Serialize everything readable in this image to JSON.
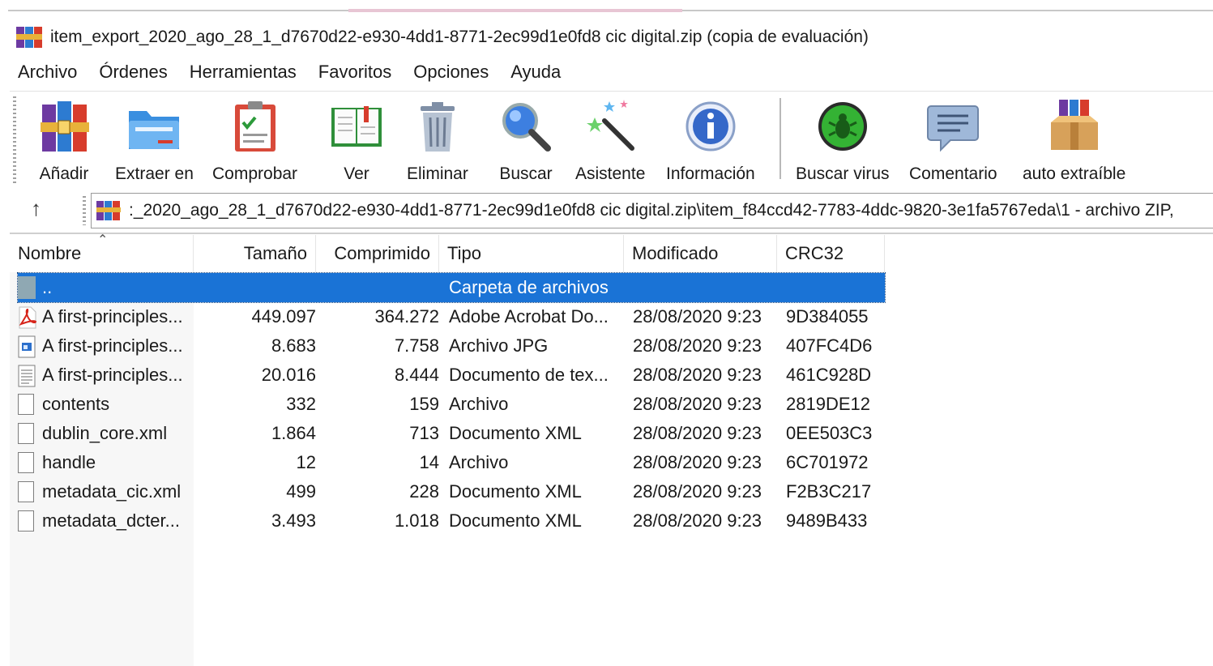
{
  "window": {
    "title": "item_export_2020_ago_28_1_d7670d22-e930-4dd1-8771-2ec99d1e0fd8 cic digital.zip (copia de evaluación)",
    "app_icon": "winrar-books-icon"
  },
  "menu": {
    "items": [
      "Archivo",
      "Órdenes",
      "Herramientas",
      "Favoritos",
      "Opciones",
      "Ayuda"
    ]
  },
  "toolbar": {
    "buttons": [
      {
        "label": "Añadir",
        "icon": "add-archive-icon"
      },
      {
        "label": "Extraer en",
        "icon": "extract-folder-icon"
      },
      {
        "label": "Comprobar",
        "icon": "test-clipboard-icon"
      },
      {
        "label": "Ver",
        "icon": "view-book-icon"
      },
      {
        "label": "Eliminar",
        "icon": "trash-icon"
      },
      {
        "label": "Buscar",
        "icon": "magnifier-icon"
      },
      {
        "label": "Asistente",
        "icon": "wizard-wand-icon"
      },
      {
        "label": "Información",
        "icon": "info-icon"
      },
      {
        "label": "Buscar virus",
        "icon": "virus-scan-icon"
      },
      {
        "label": "Comentario",
        "icon": "comment-icon"
      },
      {
        "label": "auto extraíble",
        "icon": "sfx-box-icon"
      }
    ]
  },
  "address": {
    "path": ":_2020_ago_28_1_d7670d22-e930-4dd1-8771-2ec99d1e0fd8 cic digital.zip\\item_f84ccd42-7783-4ddc-9820-3e1fa5767eda\\1 - archivo ZIP,"
  },
  "columns": {
    "name": "Nombre",
    "size": "Tamaño",
    "packed": "Comprimido",
    "type": "Tipo",
    "modified": "Modificado",
    "crc": "CRC32"
  },
  "files": [
    {
      "name": "..",
      "size": "",
      "packed": "",
      "type": "Carpeta de archivos",
      "modified": "",
      "crc": "",
      "icon": "parent-folder-icon"
    },
    {
      "name": "A first-principles...",
      "size": "449.097",
      "packed": "364.272",
      "type": "Adobe Acrobat Do...",
      "modified": "28/08/2020 9:23",
      "crc": "9D384055",
      "icon": "pdf-file-icon"
    },
    {
      "name": "A first-principles...",
      "size": "8.683",
      "packed": "7.758",
      "type": "Archivo JPG",
      "modified": "28/08/2020 9:23",
      "crc": "407FC4D6",
      "icon": "image-file-icon"
    },
    {
      "name": "A first-principles...",
      "size": "20.016",
      "packed": "8.444",
      "type": "Documento de tex...",
      "modified": "28/08/2020 9:23",
      "crc": "461C928D",
      "icon": "text-file-icon"
    },
    {
      "name": "contents",
      "size": "332",
      "packed": "159",
      "type": "Archivo",
      "modified": "28/08/2020 9:23",
      "crc": "2819DE12",
      "icon": "blank-file-icon"
    },
    {
      "name": "dublin_core.xml",
      "size": "1.864",
      "packed": "713",
      "type": "Documento XML",
      "modified": "28/08/2020 9:23",
      "crc": "0EE503C3",
      "icon": "blank-file-icon"
    },
    {
      "name": "handle",
      "size": "12",
      "packed": "14",
      "type": "Archivo",
      "modified": "28/08/2020 9:23",
      "crc": "6C701972",
      "icon": "blank-file-icon"
    },
    {
      "name": "metadata_cic.xml",
      "size": "499",
      "packed": "228",
      "type": "Documento XML",
      "modified": "28/08/2020 9:23",
      "crc": "F2B3C217",
      "icon": "blank-file-icon"
    },
    {
      "name": "metadata_dcter...",
      "size": "3.493",
      "packed": "1.018",
      "type": "Documento XML",
      "modified": "28/08/2020 9:23",
      "crc": "9489B433",
      "icon": "blank-file-icon"
    }
  ],
  "colors": {
    "selection": "#1a73d6",
    "tab_highlight": "#e8c6d4"
  }
}
